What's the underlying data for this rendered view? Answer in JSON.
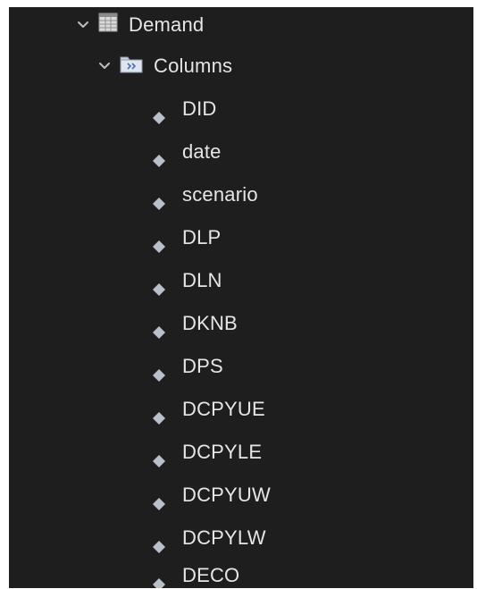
{
  "tree": {
    "table": {
      "label": "Demand",
      "expanded": true,
      "icon": "table-icon"
    },
    "folder": {
      "label": "Columns",
      "expanded": true,
      "icon": "folder-icon"
    },
    "columns": [
      {
        "label": "DID",
        "icon": "column-diamond-icon"
      },
      {
        "label": "date",
        "icon": "column-diamond-icon"
      },
      {
        "label": "scenario",
        "icon": "column-diamond-icon"
      },
      {
        "label": "DLP",
        "icon": "column-diamond-icon"
      },
      {
        "label": "DLN",
        "icon": "column-diamond-icon"
      },
      {
        "label": "DKNB",
        "icon": "column-diamond-icon"
      },
      {
        "label": "DPS",
        "icon": "column-diamond-icon"
      },
      {
        "label": "DCPYUE",
        "icon": "column-diamond-icon"
      },
      {
        "label": "DCPYLE",
        "icon": "column-diamond-icon"
      },
      {
        "label": "DCPYUW",
        "icon": "column-diamond-icon"
      },
      {
        "label": "DCPYLW",
        "icon": "column-diamond-icon"
      },
      {
        "label": "DECO",
        "icon": "column-diamond-icon"
      }
    ]
  },
  "colors": {
    "background": "#1e1e1e",
    "text": "#e6e6e6",
    "icon": "#b9c0cc"
  }
}
